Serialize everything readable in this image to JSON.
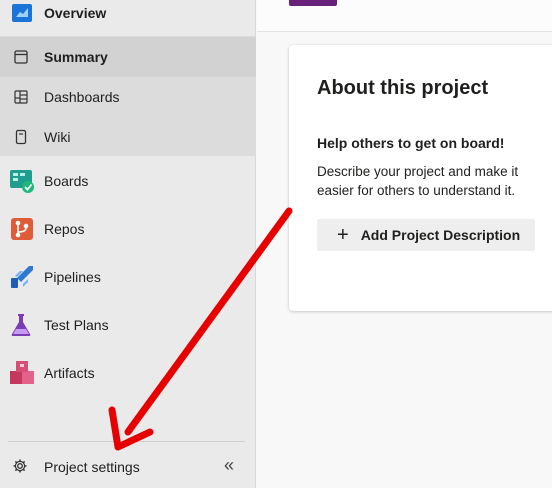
{
  "sidebar": {
    "items": [
      {
        "label": "Overview",
        "icon": "overview-icon"
      },
      {
        "label": "Summary",
        "icon": "summary-icon"
      },
      {
        "label": "Dashboards",
        "icon": "dashboards-icon"
      },
      {
        "label": "Wiki",
        "icon": "wiki-icon"
      },
      {
        "label": "Boards",
        "icon": "boards-icon"
      },
      {
        "label": "Repos",
        "icon": "repos-icon"
      },
      {
        "label": "Pipelines",
        "icon": "pipelines-icon"
      },
      {
        "label": "Test Plans",
        "icon": "test-plans-icon"
      },
      {
        "label": "Artifacts",
        "icon": "artifacts-icon"
      }
    ],
    "settings_label": "Project settings",
    "collapse_glyph": "«"
  },
  "card": {
    "title": "About this project",
    "subtitle": "Help others to get on board!",
    "description": "Describe your project and make it easier for others to understand it.",
    "button_label": "Add Project Description",
    "button_glyph": "+"
  },
  "colors": {
    "sidebar_bg": "#eaeaea",
    "selected_bg": "#d2d2d2",
    "accent_purple": "#68217a",
    "arrow_red": "#e60000"
  }
}
